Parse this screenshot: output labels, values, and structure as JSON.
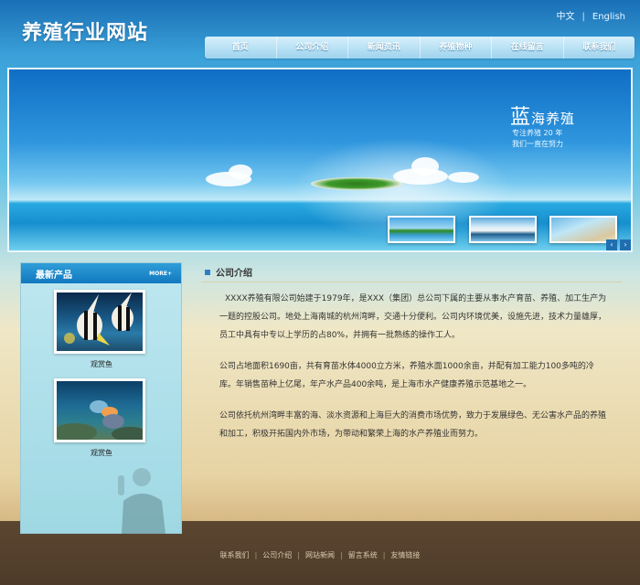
{
  "site": {
    "title": "养殖行业网站"
  },
  "lang": {
    "cn": "中文",
    "en": "English",
    "sep": "|"
  },
  "nav": {
    "items": [
      "首页",
      "公司介绍",
      "新闻资讯",
      "养殖物种",
      "在线留言",
      "联系我们"
    ]
  },
  "banner": {
    "title_big": "蓝",
    "title_rest": "海养殖",
    "sub1": "专注养殖 20 年",
    "sub2": "我们一直在努力"
  },
  "sidebar": {
    "title": "最新产品",
    "more": "MORE+",
    "products": [
      {
        "name": "观赏鱼"
      },
      {
        "name": "观赏鱼"
      }
    ]
  },
  "content": {
    "title": "公司介绍",
    "paragraphs": [
      "XXXX养殖有限公司始建于1979年，是XXX（集团）总公司下属的主要从事水产育苗、养殖、加工生产为一题的控股公司。地处上海南城的杭州湾畔，交通十分便利。公司内环境优美，设施先进，技术力量雄厚，员工中具有中专以上学历的占80%，并拥有一批熟练的操作工人。",
      "公司占地面积1690亩，共有育苗水体4000立方米，养殖水面1000余亩，并配有加工能力100多吨的冷库。年销售苗种上亿尾，年产水产品400余吨，是上海市水产健康养殖示范基地之一。",
      "公司依托杭州湾畔丰富的海、淡水资源和上海巨大的消费市场优势，致力于发展绿色、无公害水产品的养殖和加工，积极开拓国内外市场，为带动和繁荣上海的水产养殖业而努力。"
    ]
  },
  "footer": {
    "links": [
      "联系我们",
      "公司介绍",
      "网站新闻",
      "留言系统",
      "友情链接"
    ],
    "sep": "|"
  }
}
